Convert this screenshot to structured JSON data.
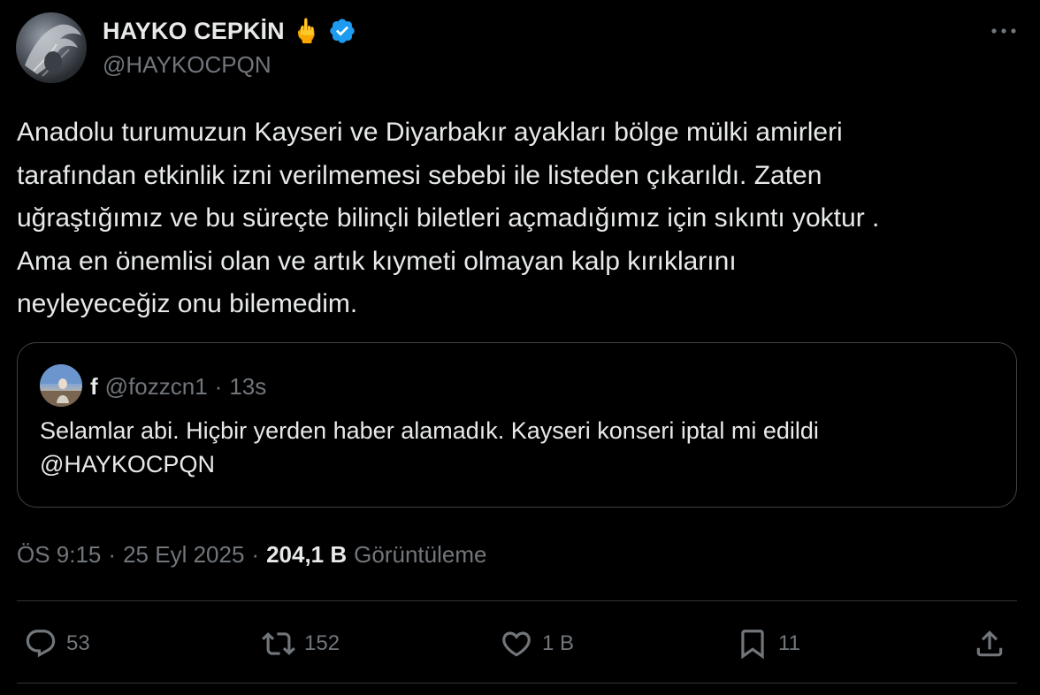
{
  "author": {
    "display_name": "HAYKO CEPKİN",
    "emoji": "🖕",
    "handle": "@HAYKOCPQN"
  },
  "tweet": {
    "lines": [
      "Anadolu turumuzun Kayseri ve Diyarbakır ayakları bölge mülki amirleri",
      "tarafından etkinlik izni verilmemesi sebebi ile listeden çıkarıldı. Zaten",
      "uğraştığımız ve bu süreçte bilinçli biletleri açmadığımız için sıkıntı yoktur .",
      "Ama en önemlisi olan ve artık kıymeti olmayan kalp kırıklarını",
      "neyleyeceğiz onu bilemedim."
    ]
  },
  "quote": {
    "name": "f",
    "handle": "@fozzcn1",
    "separator": "·",
    "time": "13s",
    "lines": [
      "Selamlar abi. Hiçbir yerden haber alamadık. Kayseri konseri iptal mi edildi",
      "@HAYKOCPQN"
    ]
  },
  "meta": {
    "time": "ÖS 9:15",
    "sep1": "·",
    "date": "25 Eyl 2025",
    "sep2": "·",
    "views_count": "204,1 B",
    "views_label": "Görüntüleme"
  },
  "actions": {
    "replies": "53",
    "reposts": "152",
    "likes": "1 B",
    "bookmarks": "11"
  },
  "colors": {
    "background": "#000000",
    "text": "#e7e9ea",
    "muted": "#71767b",
    "verified": "#1d9bf0",
    "border": "#2f3336"
  },
  "icons": {
    "verified": "verified-badge-icon",
    "more": "more-dots-icon",
    "reply": "reply-icon",
    "repost": "repost-icon",
    "like": "heart-icon",
    "bookmark": "bookmark-icon",
    "share": "share-icon"
  }
}
